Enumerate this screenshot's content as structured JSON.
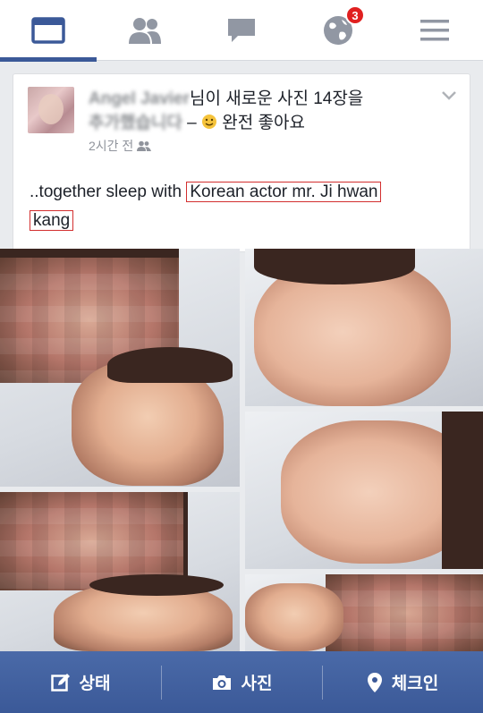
{
  "nav": {
    "items": [
      {
        "icon": "news-feed-icon",
        "active": true
      },
      {
        "icon": "friends-icon",
        "active": false
      },
      {
        "icon": "messages-icon",
        "active": false
      },
      {
        "icon": "notifications-globe-icon",
        "active": false,
        "badge": "3"
      },
      {
        "icon": "menu-icon",
        "active": false
      }
    ],
    "accent": "#3b5998",
    "badge_color": "#e02020"
  },
  "post": {
    "author": "Angel Javier",
    "action_text": "님이 새로운 사진 14장을",
    "action_text_2": "추가했습니다",
    "dash": " – ",
    "feeling_text": "완전 좋아요",
    "time": "2시간 전",
    "body_plain": "..together sleep with ",
    "body_highlight_1": "Korean actor mr. Ji hwan",
    "body_highlight_2": "kang",
    "highlight_color": "#d32f2f"
  },
  "bottombar": {
    "status_label": "상태",
    "photo_label": "사진",
    "checkin_label": "체크인"
  }
}
